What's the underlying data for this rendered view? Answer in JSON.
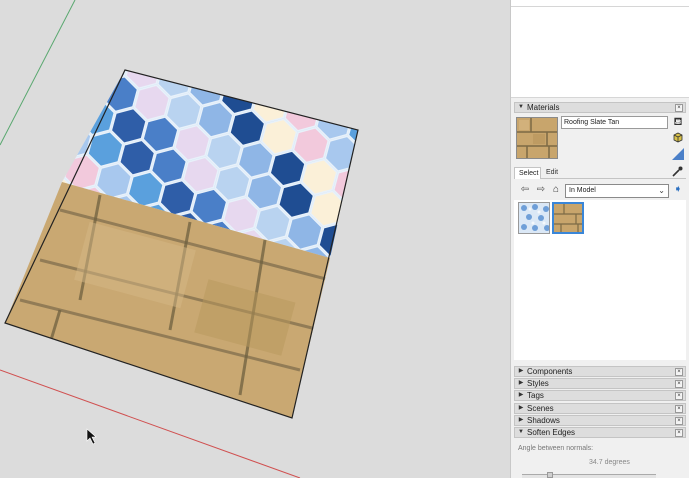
{
  "materials_panel": {
    "title": "Materials",
    "material_name": "Roofing Slate Tan",
    "tabs": [
      "Select",
      "Edit"
    ],
    "library": "In Model",
    "icons": [
      "back-arrow-icon",
      "forward-arrow-icon",
      "home-icon",
      "dropdown-chevron-icon",
      "details-arrow-icon",
      "eyedropper-icon",
      "paint-bucket-icon",
      "3d-box-icon",
      "triangle-icon"
    ]
  },
  "collapsed_panels": [
    "Components",
    "Styles",
    "Tags",
    "Scenes",
    "Shadows"
  ],
  "soften_edges": {
    "title": "Soften Edges",
    "angle_label": "Angle between normals:",
    "angle_value": "34.7",
    "angle_unit": "degrees"
  }
}
